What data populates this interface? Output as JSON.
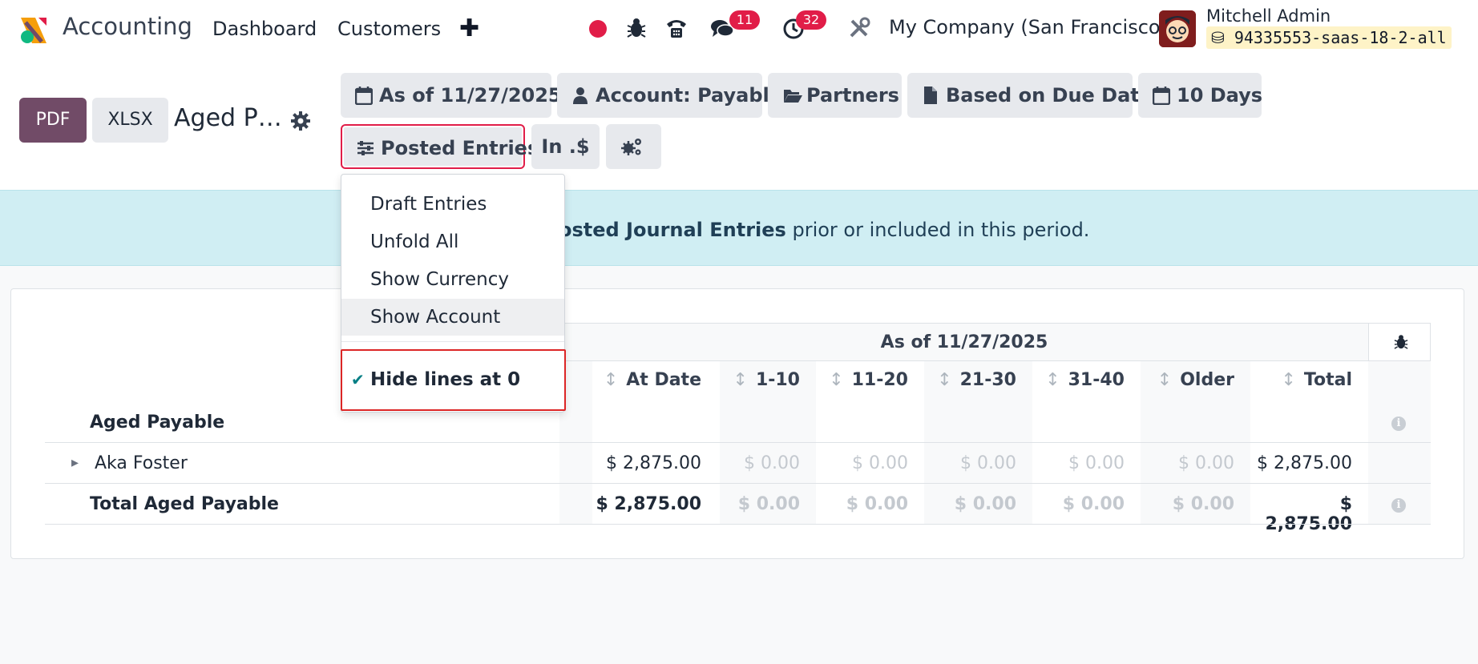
{
  "navbar": {
    "app_title": "Accounting",
    "menu": [
      "Dashboard",
      "Customers"
    ],
    "plus": "✚",
    "messages_count": "11",
    "activities_count": "32",
    "company": "My Company (San Francisco)",
    "user_name": "Mitchell Admin",
    "database": "94335553-saas-18-2-all"
  },
  "control_panel": {
    "pdf_label": "PDF",
    "xlsx_label": "XLSX",
    "report_title": "Aged P…",
    "filters": {
      "date": "As of 11/27/2025",
      "account": "Account: Payable",
      "partners": "Partners",
      "based_on": "Based on Due Date",
      "period": "10 Days",
      "posted": "Posted Entries",
      "currency": "In .$"
    }
  },
  "dropdown": {
    "items": [
      "Draft Entries",
      "Unfold All",
      "Show Currency",
      "Show Account"
    ],
    "checked_item": "Hide lines at 0",
    "check": "✔"
  },
  "banner": {
    "bold_text": "osted Journal Entries",
    "rest_text": " prior or included in this period."
  },
  "report": {
    "column_group": "As of 11/27/2025",
    "section_title": "Aged Payable",
    "columns": [
      "At Date",
      "1-10",
      "11-20",
      "21-30",
      "31-40",
      "Older",
      "Total"
    ],
    "sort_glyph": "↕",
    "expand_glyph": "▸",
    "info_glyph": "i",
    "rows": [
      {
        "label": "Aka Foster",
        "values": [
          "$ 2,875.00",
          "$ 0.00",
          "$ 0.00",
          "$ 0.00",
          "$ 0.00",
          "$ 0.00",
          "$ 2,875.00"
        ]
      }
    ],
    "total": {
      "label": "Total Aged Payable",
      "values": [
        "$ 2,875.00",
        "$ 0.00",
        "$ 0.00",
        "$ 0.00",
        "$ 0.00",
        "$ 0.00",
        "$ 2,875.00"
      ]
    }
  },
  "colors": {
    "brand": "#714b67",
    "badge": "#e11d48",
    "banner_bg": "#d0eef3",
    "highlight_outline": "#dc2626",
    "check": "#017e84"
  }
}
